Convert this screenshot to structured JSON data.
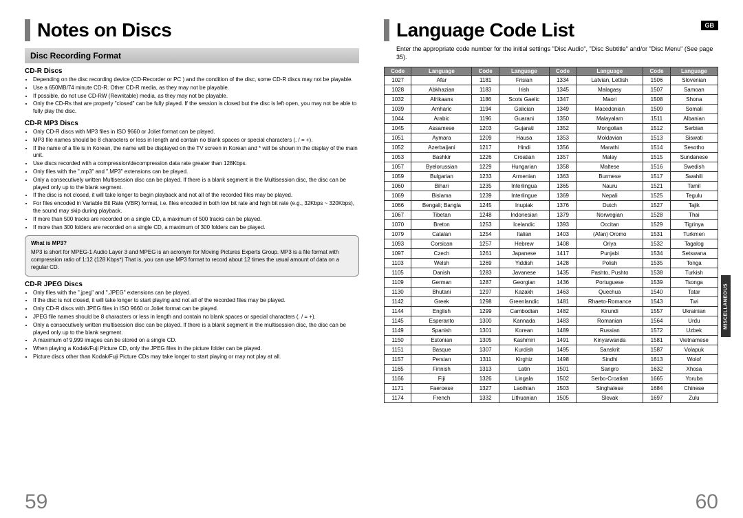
{
  "badge": "GB",
  "side_tab": "MISCELLANEOUS",
  "page_left": "59",
  "page_right": "60",
  "left": {
    "title": "Notes on Discs",
    "section": "Disc Recording Format",
    "cdr": {
      "head": "CD-R Discs",
      "items": [
        "Depending on the disc recording device (CD-Recorder or PC ) and the condition of the disc, some CD-R discs may not be playable.",
        "Use a 650MB/74 minute CD-R. Other CD-R media, as they may not be playable.",
        "If possible, do not use CD-RW (Rewritable) media, as they may not be playable.",
        "Only the CD-Rs that are properly \"closed\" can be fully played. If the session is closed but the disc is left open, you may not be able to fully play the disc."
      ]
    },
    "mp3": {
      "head": "CD-R MP3 Discs",
      "items": [
        "Only CD-R discs with MP3 files in ISO 9660 or Joliet format can be played.",
        "MP3 file names should be 8 characters or less in length and contain no blank spaces or special characters (. / = +).",
        "If the name of a file is in Korean, the name will be displayed on the TV screen in Korean and * will be shown in the display of the main unit.",
        "Use discs recorded with a compression/decompression data rate greater than 128Kbps.",
        "Only files with the \".mp3\" and \".MP3\" extensions can be played.",
        "Only a consecutively written Multisession disc can be played. If there is a blank segment in the Multisession disc, the disc can be played only up to the blank segment.",
        "If the disc is not closed, it will take longer to begin playback and not all of the recorded files may be played.",
        "For files encoded in Variable Bit Rate (VBR) format, i.e. files encoded in both low bit rate and high bit rate (e.g., 32Kbps ~ 320Kbps), the sound may skip during playback.",
        "If more than 500 tracks are recorded on a single CD, a maximum of 500 tracks can be played.",
        "If more than 300 folders are recorded on a single CD, a maximum of 300 folders can be played."
      ],
      "box": {
        "q": "What is MP3?",
        "a": "MP3 is short for MPEG-1 Audio Layer 3 and MPEG is an acronym for Moving Pictures Experts Group. MP3 is a file format with compression ratio of 1:12 (128 Kbps*) That is, you can use MP3 format to record about 12 times the usual amount of data on a regular CD."
      }
    },
    "jpeg": {
      "head": "CD-R JPEG Discs",
      "items": [
        "Only files with the \".jpeg\" and \".JPEG\" extensions can be played.",
        "If the disc is not closed, it will take longer to start playing and not all of the recorded files may be played.",
        "Only CD-R discs with JPEG files in ISO 9660 or Joliet format can be played.",
        "JPEG file names should be 8 characters or less in length and contain no blank spaces or special characters (. / = +).",
        "Only a consecutively written multisession disc can be played. If there is a blank segment in the multisession disc, the disc can be played only up to the blank segment.",
        "A maximum of 9,999 images can be stored on a single CD.",
        "When playing a Kodak/Fuji Picture CD, only the JPEG files in the picture folder can be played.",
        "Picture discs other than Kodak/Fuji Picture CDs may take longer to start playing or may not play at all."
      ]
    }
  },
  "right": {
    "title": "Language Code List",
    "intro": "Enter the appropriate code number for the initial settings \"Disc Audio\", \"Disc Subtitle\" and/or \"Disc Menu\" (See page 35).",
    "headers": {
      "code": "Code",
      "lang": "Language"
    },
    "chart_data": {
      "type": "table",
      "columns": [
        "Code",
        "Language",
        "Code",
        "Language",
        "Code",
        "Language",
        "Code",
        "Language"
      ],
      "rows": [
        [
          "1027",
          "Afar",
          "1181",
          "Frisian",
          "1334",
          "Latvian, Lettish",
          "1506",
          "Slovenian"
        ],
        [
          "1028",
          "Abkhazian",
          "1183",
          "Irish",
          "1345",
          "Malagasy",
          "1507",
          "Samoan"
        ],
        [
          "1032",
          "Afrikaans",
          "1186",
          "Scots Gaelic",
          "1347",
          "Maori",
          "1508",
          "Shona"
        ],
        [
          "1039",
          "Amharic",
          "1194",
          "Galician",
          "1349",
          "Macedonian",
          "1509",
          "Somali"
        ],
        [
          "1044",
          "Arabic",
          "1196",
          "Guarani",
          "1350",
          "Malayalam",
          "1511",
          "Albanian"
        ],
        [
          "1045",
          "Assamese",
          "1203",
          "Gujarati",
          "1352",
          "Mongolian",
          "1512",
          "Serbian"
        ],
        [
          "1051",
          "Aymara",
          "1209",
          "Hausa",
          "1353",
          "Moldavian",
          "1513",
          "Siswati"
        ],
        [
          "1052",
          "Azerbaijani",
          "1217",
          "Hindi",
          "1356",
          "Marathi",
          "1514",
          "Sesotho"
        ],
        [
          "1053",
          "Bashkir",
          "1226",
          "Croatian",
          "1357",
          "Malay",
          "1515",
          "Sundanese"
        ],
        [
          "1057",
          "Byelorussian",
          "1229",
          "Hungarian",
          "1358",
          "Maltese",
          "1516",
          "Swedish"
        ],
        [
          "1059",
          "Bulgarian",
          "1233",
          "Armenian",
          "1363",
          "Burmese",
          "1517",
          "Swahili"
        ],
        [
          "1060",
          "Bihari",
          "1235",
          "Interlingua",
          "1365",
          "Nauru",
          "1521",
          "Tamil"
        ],
        [
          "1069",
          "Bislama",
          "1239",
          "Interlingue",
          "1369",
          "Nepali",
          "1525",
          "Tegulu"
        ],
        [
          "1066",
          "Bengali; Bangla",
          "1245",
          "Inupiak",
          "1376",
          "Dutch",
          "1527",
          "Tajik"
        ],
        [
          "1067",
          "Tibetan",
          "1248",
          "Indonesian",
          "1379",
          "Norwegian",
          "1528",
          "Thai"
        ],
        [
          "1070",
          "Breton",
          "1253",
          "Icelandic",
          "1393",
          "Occitan",
          "1529",
          "Tigrinya"
        ],
        [
          "1079",
          "Catalan",
          "1254",
          "Italian",
          "1403",
          "(Afan) Oromo",
          "1531",
          "Turkmen"
        ],
        [
          "1093",
          "Corsican",
          "1257",
          "Hebrew",
          "1408",
          "Oriya",
          "1532",
          "Tagalog"
        ],
        [
          "1097",
          "Czech",
          "1261",
          "Japanese",
          "1417",
          "Punjabi",
          "1534",
          "Setswana"
        ],
        [
          "1103",
          "Welsh",
          "1269",
          "Yiddish",
          "1428",
          "Polish",
          "1535",
          "Tonga"
        ],
        [
          "1105",
          "Danish",
          "1283",
          "Javanese",
          "1435",
          "Pashto, Pushto",
          "1538",
          "Turkish"
        ],
        [
          "1109",
          "German",
          "1287",
          "Georgian",
          "1436",
          "Portuguese",
          "1539",
          "Tsonga"
        ],
        [
          "1130",
          "Bhutani",
          "1297",
          "Kazakh",
          "1463",
          "Quechua",
          "1540",
          "Tatar"
        ],
        [
          "1142",
          "Greek",
          "1298",
          "Greenlandic",
          "1481",
          "Rhaeto-Romance",
          "1543",
          "Twi"
        ],
        [
          "1144",
          "English",
          "1299",
          "Cambodian",
          "1482",
          "Kirundi",
          "1557",
          "Ukrainian"
        ],
        [
          "1145",
          "Esperanto",
          "1300",
          "Kannada",
          "1483",
          "Romanian",
          "1564",
          "Urdu"
        ],
        [
          "1149",
          "Spanish",
          "1301",
          "Korean",
          "1489",
          "Russian",
          "1572",
          "Uzbek"
        ],
        [
          "1150",
          "Estonian",
          "1305",
          "Kashmiri",
          "1491",
          "Kinyarwanda",
          "1581",
          "Vietnamese"
        ],
        [
          "1151",
          "Basque",
          "1307",
          "Kurdish",
          "1495",
          "Sanskrit",
          "1587",
          "Volapuk"
        ],
        [
          "1157",
          "Persian",
          "1311",
          "Kirghiz",
          "1498",
          "Sindhi",
          "1613",
          "Wolof"
        ],
        [
          "1165",
          "Finnish",
          "1313",
          "Latin",
          "1501",
          "Sangro",
          "1632",
          "Xhosa"
        ],
        [
          "1166",
          "Fiji",
          "1326",
          "Lingala",
          "1502",
          "Serbo-Croatian",
          "1665",
          "Yoruba"
        ],
        [
          "1171",
          "Faeroese",
          "1327",
          "Laothian",
          "1503",
          "Singhalese",
          "1684",
          "Chinese"
        ],
        [
          "1174",
          "French",
          "1332",
          "Lithuanian",
          "1505",
          "Slovak",
          "1697",
          "Zulu"
        ]
      ]
    }
  }
}
